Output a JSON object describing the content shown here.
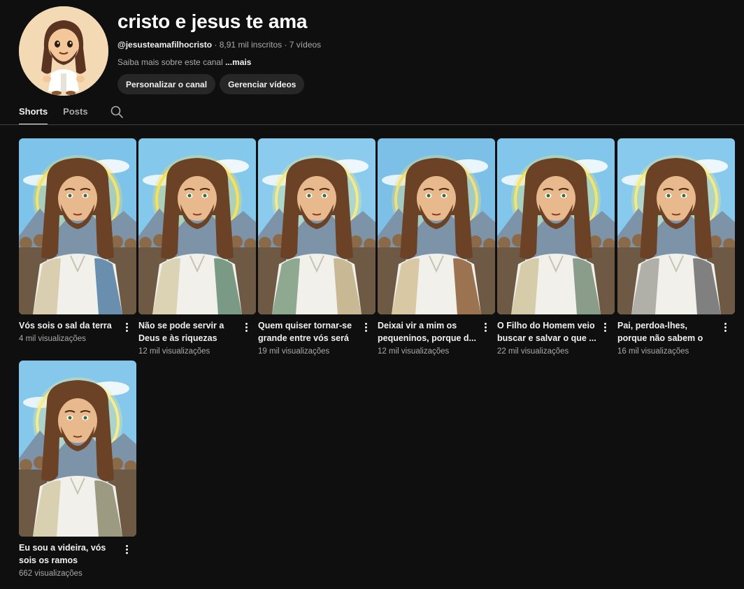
{
  "channel": {
    "title": "cristo e jesus te ama",
    "handle": "@jesusteamafilhocristo",
    "subscribers": "8,91 mil inscritos",
    "video_count": "7 vídeos",
    "separator": " · ",
    "about_text": "Saiba mais sobre este canal ",
    "about_more": "...mais",
    "avatar_icon": "cartoon-jesus-avatar"
  },
  "actions": {
    "customize_label": "Personalizar o canal",
    "manage_label": "Gerenciar vídeos"
  },
  "tabs": [
    {
      "label": "Shorts",
      "active": true
    },
    {
      "label": "Posts",
      "active": false
    }
  ],
  "search_icon": "search-icon",
  "shorts": [
    {
      "title": "Vós sois o sal da terra",
      "views": "4 mil visualizações",
      "robe": "#6a8fae",
      "sash": "#d9cfb0",
      "halo": "#f4e36a",
      "sky": "#7ec4ea"
    },
    {
      "title": "Não se pode servir a Deus e às riquezas",
      "views": "12 mil visualizações",
      "robe": "#7a9a86",
      "sash": "#dcd2b4",
      "halo": "#f7e15a",
      "sky": "#84c8ec"
    },
    {
      "title": "Quem quiser tornar-se grande entre vós será ...",
      "views": "19 mil visualizações",
      "robe": "#c8b894",
      "sash": "#8fa890",
      "halo": "#f3ea8a",
      "sky": "#8acbee"
    },
    {
      "title": "Deixai vir a mim os pequeninos, porque d...",
      "views": "12 mil visualizações",
      "robe": "#9c7350",
      "sash": "#d8c8a4",
      "halo": "#f1e07a",
      "sky": "#7cc0e8"
    },
    {
      "title": "O Filho do Homem veio buscar e salvar o que ...",
      "views": "22 mil visualizações",
      "robe": "#8a9c8a",
      "sash": "#d6ccaa",
      "halo": "#f3e46c",
      "sky": "#82c6ec"
    },
    {
      "title": "Pai, perdoa-lhes, porque não sabem o que fazem",
      "views": "16 mil visualizações",
      "robe": "#808080",
      "sash": "#b0b0a8",
      "halo": "#f5ea7e",
      "sky": "#88c9ee"
    },
    {
      "title": "Eu sou a videira, vós sois os ramos",
      "views": "662 visualizações",
      "robe": "#9c9a80",
      "sash": "#d8d0b0",
      "halo": "#f5ec8e",
      "sky": "#86c8ec"
    }
  ]
}
